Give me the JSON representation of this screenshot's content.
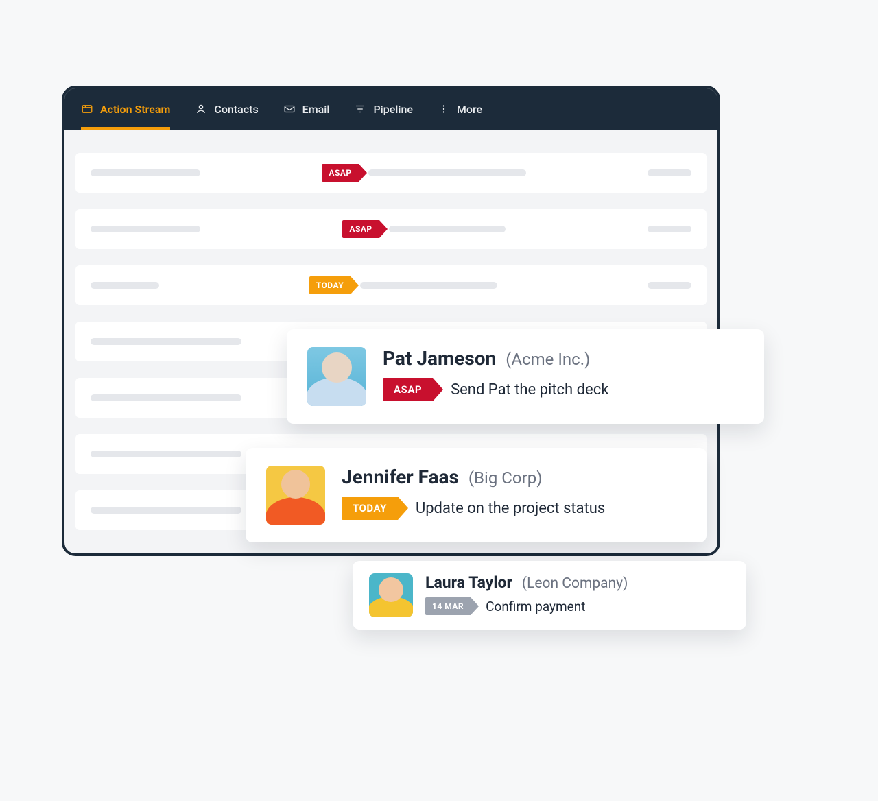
{
  "nav": {
    "items": [
      {
        "label": "Action Stream",
        "active": true
      },
      {
        "label": "Contacts",
        "active": false
      },
      {
        "label": "Email",
        "active": false
      },
      {
        "label": "Pipeline",
        "active": false
      },
      {
        "label": "More",
        "active": false
      }
    ]
  },
  "rows": [
    {
      "badge": "ASAP",
      "badge_color": "red"
    },
    {
      "badge": "ASAP",
      "badge_color": "red"
    },
    {
      "badge": "TODAY",
      "badge_color": "orange"
    },
    {
      "badge": null
    },
    {
      "badge": null
    },
    {
      "badge": null
    },
    {
      "badge": null
    }
  ],
  "cards": [
    {
      "name": "Pat Jameson",
      "company": "(Acme Inc.)",
      "badge": "ASAP",
      "badge_color": "red",
      "task": "Send Pat the pitch deck"
    },
    {
      "name": "Jennifer Faas",
      "company": "(Big Corp)",
      "badge": "TODAY",
      "badge_color": "orange",
      "task": "Update on the project status"
    },
    {
      "name": "Laura Taylor",
      "company": "(Leon Company)",
      "badge": "14 MAR",
      "badge_color": "gray",
      "task": "Confirm payment"
    }
  ]
}
